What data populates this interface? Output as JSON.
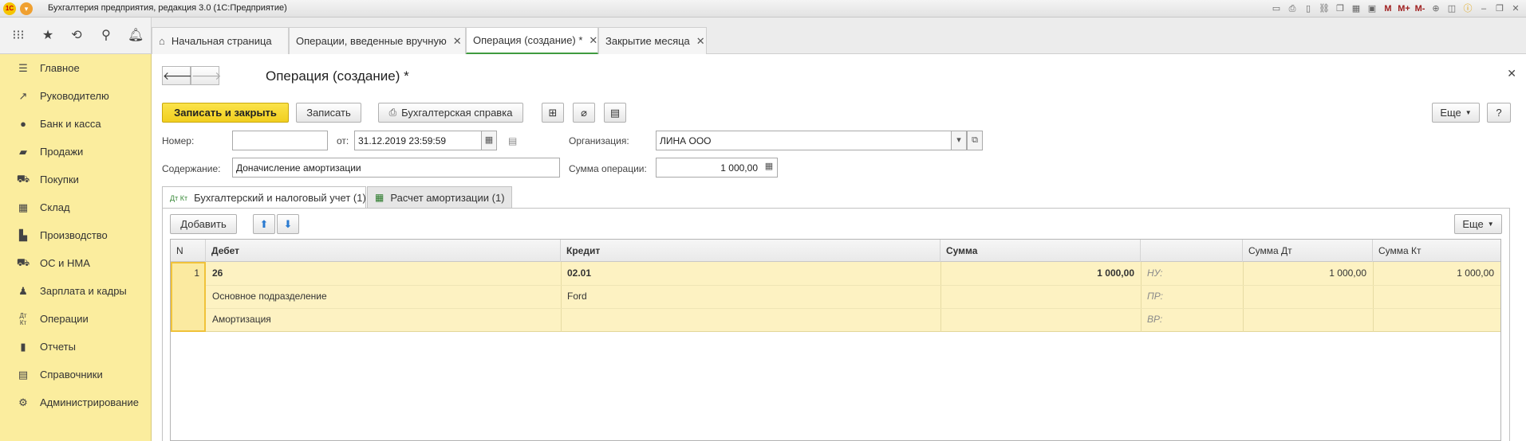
{
  "window": {
    "title": "Бухгалтерия предприятия, редакция 3.0  (1С:Предприятие)",
    "logo_text": "1С",
    "m_labels": [
      "M",
      "M+",
      "M-"
    ]
  },
  "tabs": [
    {
      "label": "Начальная страница",
      "closable": false
    },
    {
      "label": "Операции, введенные вручную",
      "closable": true
    },
    {
      "label": "Операция (создание) *",
      "closable": true,
      "active": true
    },
    {
      "label": "Закрытие месяца",
      "closable": true
    }
  ],
  "sidebar": {
    "items": [
      {
        "label": "Главное",
        "icon": "menu-lines-icon"
      },
      {
        "label": "Руководителю",
        "icon": "trend-icon"
      },
      {
        "label": "Банк и касса",
        "icon": "coin-icon"
      },
      {
        "label": "Продажи",
        "icon": "bag-icon"
      },
      {
        "label": "Покупки",
        "icon": "cart-icon"
      },
      {
        "label": "Склад",
        "icon": "grid-icon"
      },
      {
        "label": "Производство",
        "icon": "factory-icon"
      },
      {
        "label": "ОС и НМА",
        "icon": "truck-icon"
      },
      {
        "label": "Зарплата и кадры",
        "icon": "person-icon"
      },
      {
        "label": "Операции",
        "icon": "dt-kt-icon"
      },
      {
        "label": "Отчеты",
        "icon": "bar-chart-icon"
      },
      {
        "label": "Справочники",
        "icon": "book-icon"
      },
      {
        "label": "Администрирование",
        "icon": "gear-icon"
      }
    ]
  },
  "form": {
    "title": "Операция (создание) *",
    "buttons": {
      "save_close": "Записать и закрыть",
      "save": "Записать",
      "report": "Бухгалтерская справка",
      "more": "Еще",
      "help": "?"
    },
    "fields": {
      "number_label": "Номер:",
      "number_value": "",
      "date_label": "от:",
      "date_value": "31.12.2019 23:59:59",
      "org_label": "Организация:",
      "org_value": "ЛИНА ООО",
      "content_label": "Содержание:",
      "content_value": "Доначисление амортизации",
      "sum_label": "Сумма операции:",
      "sum_value": "1 000,00"
    },
    "inner_tabs": [
      {
        "label": "Бухгалтерский и налоговый учет (1)",
        "icon_text": "Дт Кт",
        "active": true
      },
      {
        "label": "Расчет амортизации (1)",
        "icon_text": "▦",
        "active": false
      }
    ],
    "table_toolbar": {
      "add": "Добавить",
      "more": "Еще"
    },
    "table": {
      "headers": {
        "n": "N",
        "debit": "Дебет",
        "credit": "Кредит",
        "sum": "Сумма",
        "sum_dt": "Сумма Дт",
        "sum_kt": "Сумма Кт"
      },
      "row": {
        "n": "1",
        "debit_account": "26",
        "debit_sub1": "Основное подразделение",
        "debit_sub2": "Амортизация",
        "credit_account": "02.01",
        "credit_sub1": "Ford",
        "sum": "1 000,00",
        "nu_label": "НУ:",
        "pr_label": "ПР:",
        "vr_label": "ВР:",
        "sum_dt": "1 000,00",
        "sum_kt": "1 000,00"
      }
    }
  }
}
